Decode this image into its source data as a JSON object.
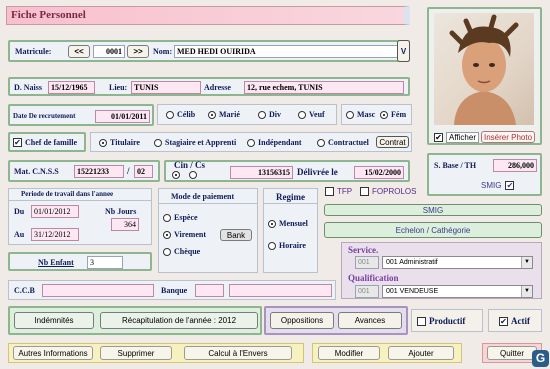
{
  "title": "Fiche Personnel",
  "matricule": {
    "label": "Matricule:",
    "value": "0001",
    "prev": "<<",
    "next": ">>"
  },
  "nom": {
    "label": "Nom:",
    "value": "MED HEDI OUIRIDA",
    "dropdown": "V"
  },
  "naissance": {
    "label": "D. Naiss",
    "value": "15/12/1965"
  },
  "lieu": {
    "label": "Lieu:",
    "value": "TUNIS"
  },
  "adresse": {
    "label": "Adresse",
    "value": "12, rue echem, TUNIS"
  },
  "recrutement": {
    "label": "Date De recrutement",
    "value": "01/01/2011"
  },
  "etat_civil": {
    "options": [
      "Célib",
      "Marié",
      "Div",
      "Veuf"
    ],
    "selected": "Marié"
  },
  "sexe": {
    "options": [
      "Masc",
      "Fém"
    ],
    "selected": "Fém"
  },
  "chef_famille": {
    "label": "Chef de famille",
    "checked": true
  },
  "statut": {
    "options": [
      "Titulaire",
      "Stagiaire et Apprenti",
      "Indépendant",
      "Contractuel"
    ],
    "selected": "Titulaire",
    "contrat_button": "Contrat"
  },
  "cnss": {
    "label": "Mat. C.N.S.S",
    "value": "15221233",
    "sep": "/",
    "suffix": "02"
  },
  "cin": {
    "label": "Cin / Cs",
    "value": "13156315",
    "delivree_label": "Délivrée le",
    "delivree_value": "15/02/2000"
  },
  "photo": {
    "afficher_label": "Afficher",
    "afficher_checked": true,
    "inserer_label": "Insérer Photo"
  },
  "salaire": {
    "label": "S. Base / TH",
    "value": "286,000",
    "smig_label": "SMIG",
    "smig_checked": true
  },
  "periode": {
    "title": "Periode de travail dans l'annee",
    "du_label": "Du",
    "du_value": "01/01/2012",
    "au_label": "Au",
    "au_value": "31/12/2012",
    "jours_label": "Nb Jours",
    "jours_value": "364"
  },
  "paiement": {
    "title": "Mode de paiement",
    "options": [
      "Espèce",
      "Virement",
      "Chèque"
    ],
    "selected": "Virement",
    "bank_label": "Bank"
  },
  "regime": {
    "title": "Regime",
    "options": [
      "Mensuel",
      "Horaire"
    ],
    "selected": "Mensuel"
  },
  "tfp": {
    "label": "TFP",
    "checked": false
  },
  "foprolos": {
    "label": "FOPROLOS",
    "checked": false
  },
  "smig_button": "SMIG",
  "echelon_button": "Echelon / Cathégorie",
  "enfant": {
    "label": "Nb Enfant",
    "value": "3"
  },
  "ccb": {
    "label": "C.C.B"
  },
  "banque": {
    "label": "Banque"
  },
  "service": {
    "label": "Service.",
    "code": "001",
    "value": "001 Administratif"
  },
  "qualification": {
    "label": "Qualification",
    "code": "001",
    "value": "001 VENDEUSE"
  },
  "buttons": {
    "indemnites": "Indémnités",
    "recap": "Récapitulation de l'année : 2012",
    "oppositions": "Oppositions",
    "avances": "Avances",
    "autres": "Autres Informations",
    "supprimer": "Supprimer",
    "calcul": "Calcul à l'Envers",
    "modifier": "Modifier",
    "ajouter": "Ajouter",
    "quitter": "Quitter"
  },
  "productif": {
    "label": "Productif",
    "checked": false
  },
  "actif": {
    "label": "Actif",
    "checked": true
  }
}
